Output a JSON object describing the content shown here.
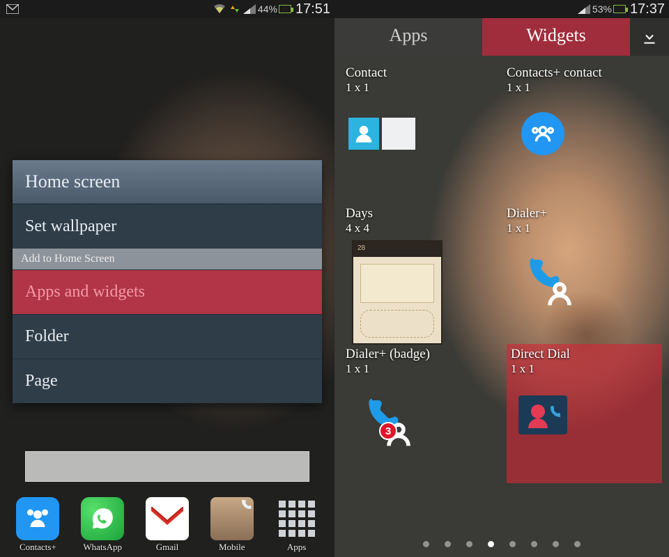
{
  "left": {
    "status": {
      "battery_pct": "44%",
      "time": "17:51"
    },
    "menu": {
      "header": "Home screen",
      "set_wallpaper": "Set wallpaper",
      "subheader": "Add to Home Screen",
      "apps_widgets": "Apps and widgets",
      "folder": "Folder",
      "page": "Page"
    },
    "dock": {
      "contacts": "Contacts+",
      "whatsapp": "WhatsApp",
      "gmail": "Gmail",
      "mobile": "Mobile",
      "apps": "Apps"
    }
  },
  "right": {
    "status": {
      "battery_pct": "53%",
      "time": "17:37"
    },
    "tabs": {
      "apps": "Apps",
      "widgets": "Widgets"
    },
    "widgets": {
      "contact": {
        "title": "Contact",
        "size": "1 x 1"
      },
      "contactsplus": {
        "title": "Contacts+ contact",
        "size": "1 x 1"
      },
      "days": {
        "title": "Days",
        "size": "4 x 4",
        "bar": "28"
      },
      "dialerplus": {
        "title": "Dialer+",
        "size": "1 x 1"
      },
      "dialerbadge": {
        "title": "Dialer+ (badge)",
        "size": "1 x 1",
        "badge": "3"
      },
      "directdial": {
        "title": "Direct Dial",
        "size": "1 x 1"
      }
    },
    "pages": {
      "count": 8,
      "current": 4
    }
  }
}
